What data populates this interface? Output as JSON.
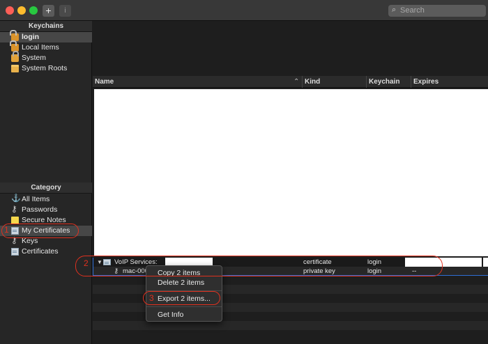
{
  "toolbar": {
    "add_label": "+",
    "info_label": "i",
    "search_placeholder": "Search"
  },
  "sidebar": {
    "keychains_header": "Keychains",
    "keychains": [
      {
        "label": "login",
        "icon": "lock-open-icon"
      },
      {
        "label": "Local Items",
        "icon": "lock-open-icon"
      },
      {
        "label": "System",
        "icon": "lock-icon"
      },
      {
        "label": "System Roots",
        "icon": "folder-icon"
      }
    ],
    "category_header": "Category",
    "categories": [
      {
        "label": "All Items",
        "icon": "all-items-icon"
      },
      {
        "label": "Passwords",
        "icon": "key-icon"
      },
      {
        "label": "Secure Notes",
        "icon": "note-icon"
      },
      {
        "label": "My Certificates",
        "icon": "certificate-icon"
      },
      {
        "label": "Keys",
        "icon": "key-icon"
      },
      {
        "label": "Certificates",
        "icon": "certificate-icon"
      }
    ]
  },
  "table": {
    "columns": [
      "Name",
      "Kind",
      "Keychain",
      "Expires"
    ],
    "rows": [
      {
        "name": "VoIP Services:",
        "kind": "certificate",
        "keychain": "login",
        "expires": ""
      },
      {
        "name": "mac-000",
        "kind": "private key",
        "keychain": "login",
        "expires": "--"
      }
    ]
  },
  "context_menu": {
    "items": [
      "Copy 2 items",
      "Delete 2 items",
      "Export 2 items...",
      "Get Info"
    ]
  },
  "annotations": {
    "step1": "1",
    "step2": "2",
    "step3": "3",
    "color": "#e0311f"
  }
}
